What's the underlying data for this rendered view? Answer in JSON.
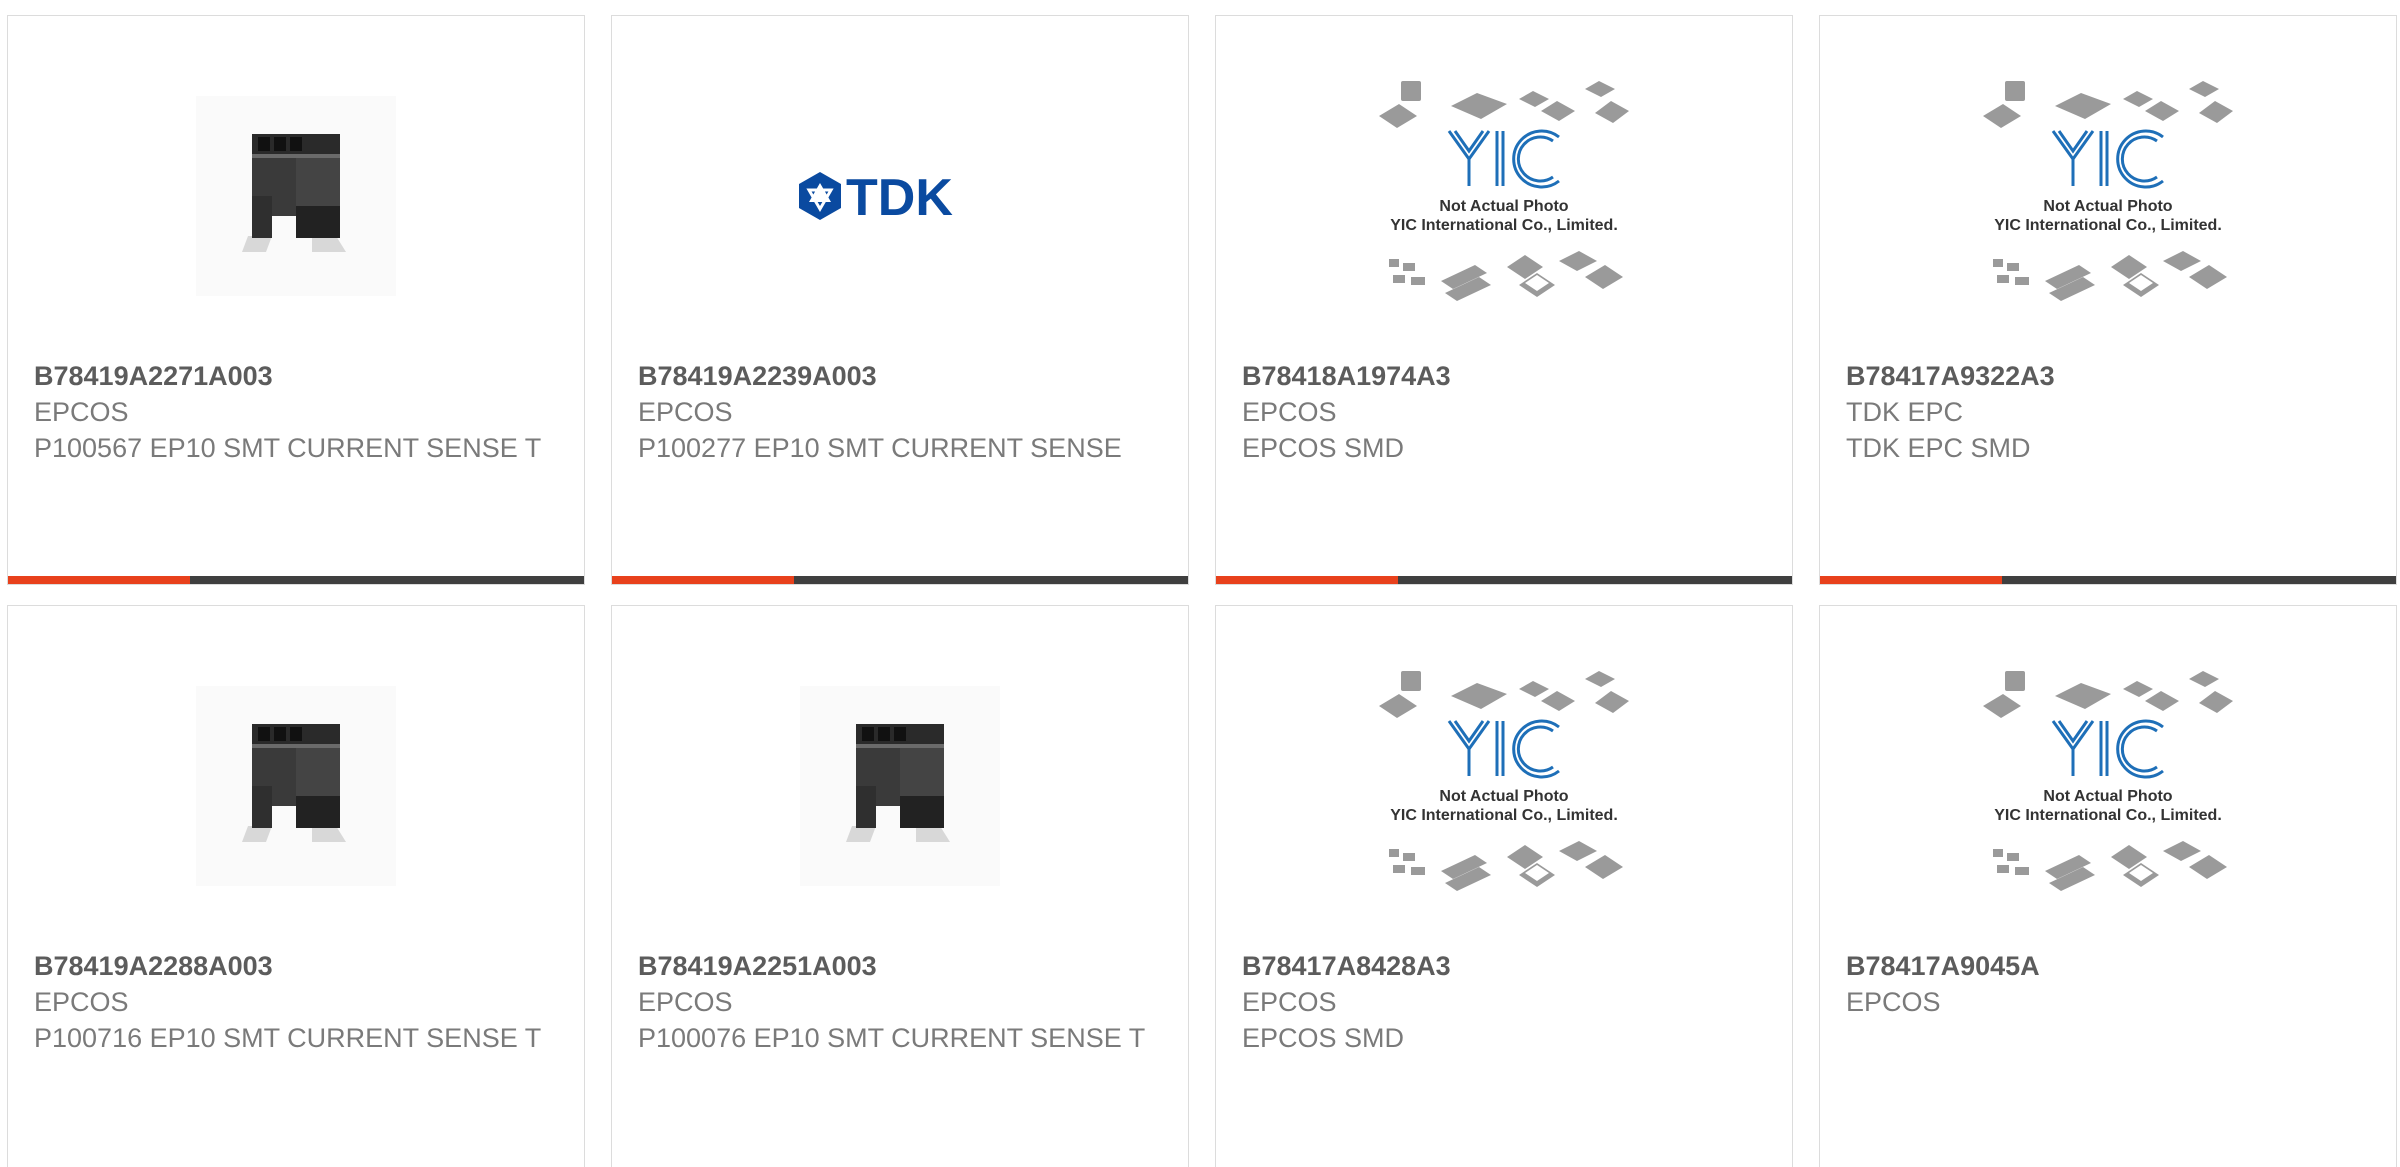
{
  "colors": {
    "accent": "#e8411c",
    "bar": "#3f3f3f",
    "border": "#dcdcdc",
    "text_bold": "#5c5c5c",
    "text": "#7a7a7a",
    "tdk_blue": "#0a4aa0",
    "yic_blue": "#1e6fb8"
  },
  "placeholder_text": {
    "line1": "Not Actual Photo",
    "line2": "YIC International Co., Limited."
  },
  "tdk_logo_text": "TDK",
  "products": [
    {
      "part_number": "B78419A2271A003",
      "manufacturer": "EPCOS",
      "description": "P100567 EP10 SMT CURRENT SENSE T",
      "image": "component-photo"
    },
    {
      "part_number": "B78419A2239A003",
      "manufacturer": "EPCOS",
      "description": "P100277 EP10 SMT CURRENT SENSE",
      "image": "tdk-logo"
    },
    {
      "part_number": "B78418A1974A3",
      "manufacturer": "EPCOS",
      "description": "EPCOS SMD",
      "image": "yic-placeholder"
    },
    {
      "part_number": "B78417A9322A3",
      "manufacturer": "TDK EPC",
      "description": "TDK EPC SMD",
      "image": "yic-placeholder"
    },
    {
      "part_number": "B78419A2288A003",
      "manufacturer": "EPCOS",
      "description": "P100716 EP10 SMT CURRENT SENSE T",
      "image": "component-photo"
    },
    {
      "part_number": "B78419A2251A003",
      "manufacturer": "EPCOS",
      "description": "P100076 EP10 SMT CURRENT SENSE T",
      "image": "component-photo"
    },
    {
      "part_number": "B78417A8428A3",
      "manufacturer": "EPCOS",
      "description": "EPCOS SMD",
      "image": "yic-placeholder"
    },
    {
      "part_number": "B78417A9045A",
      "manufacturer": "EPCOS",
      "description": "",
      "image": "yic-placeholder"
    }
  ]
}
